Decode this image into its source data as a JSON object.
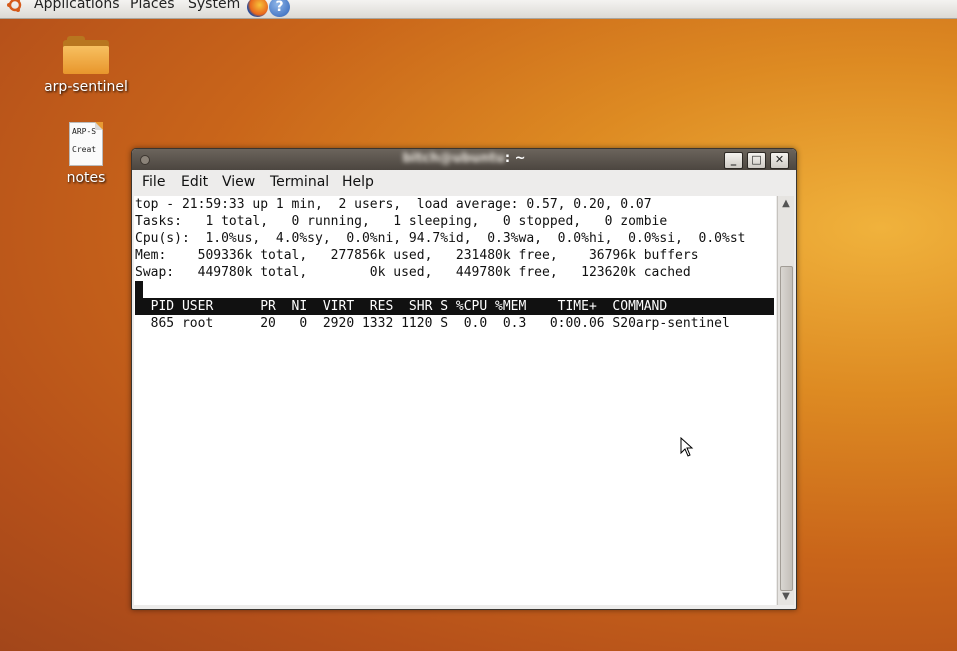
{
  "panel": {
    "applications": "Applications",
    "places": "Places",
    "system": "System"
  },
  "desktop": {
    "icons": [
      {
        "label": "arp-sentinel"
      },
      {
        "label": "notes",
        "preview_lines": [
          "ARP-S",
          "Creat"
        ]
      }
    ]
  },
  "window": {
    "title_suffix": ": ~",
    "title_user": "bitch@ubuntu",
    "buttons": {
      "minimize": "_",
      "maximize": "□",
      "close": "✕"
    },
    "menu": [
      "File",
      "Edit",
      "View",
      "Terminal",
      "Help"
    ]
  },
  "terminal": {
    "lines": [
      "top - 21:59:33 up 1 min,  2 users,  load average: 0.57, 0.20, 0.07",
      "Tasks:   1 total,   0 running,   1 sleeping,   0 stopped,   0 zombie",
      "Cpu(s):  1.0%us,  4.0%sy,  0.0%ni, 94.7%id,  0.3%wa,  0.0%hi,  0.0%si,  0.0%st",
      "Mem:    509336k total,   277856k used,   231480k free,    36796k buffers",
      "Swap:   449780k total,        0k used,   449780k free,   123620k cached"
    ],
    "header": "  PID USER      PR  NI  VIRT  RES  SHR S %CPU %MEM    TIME+  COMMAND",
    "rows": [
      "  865 root      20   0  2920 1332 1120 S  0.0  0.3   0:00.06 S20arp-sentinel"
    ]
  },
  "colors": {
    "desktop_orange": "#dd8a22",
    "titlebar": "#4c4640",
    "header_bg": "#111111"
  }
}
